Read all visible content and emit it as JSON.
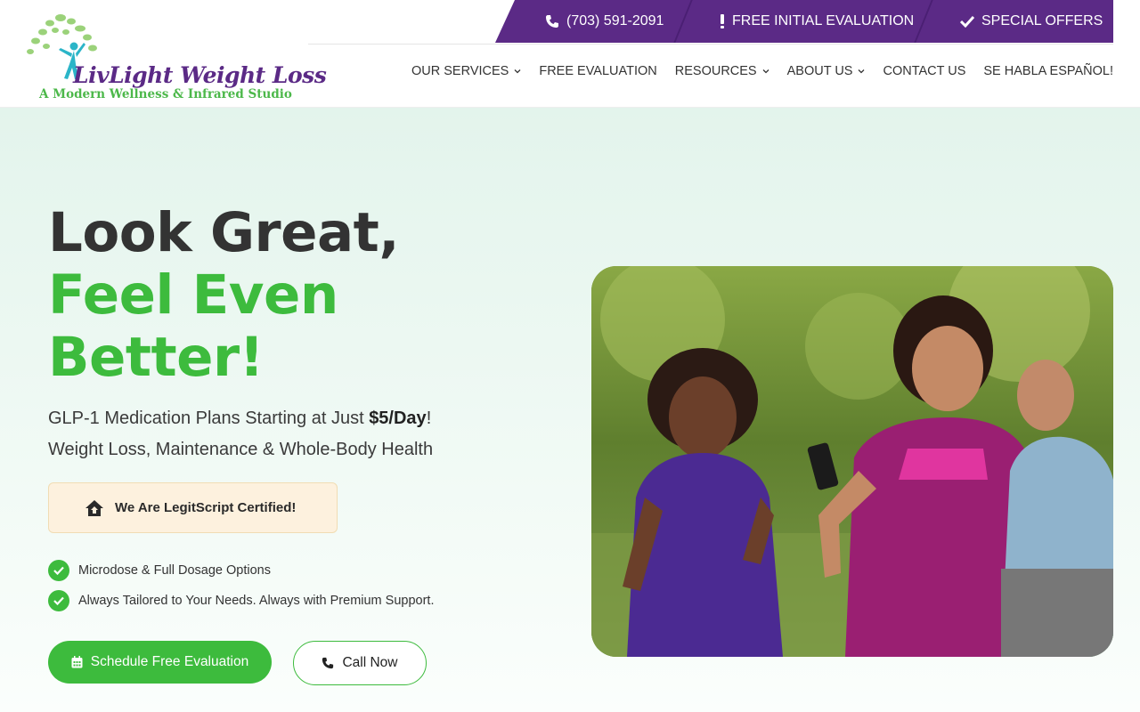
{
  "brand": {
    "name": "LivLight Weight Loss",
    "tagline": "A Modern Wellness & Infrared Studio",
    "colors": {
      "purple": "#5b2a86",
      "green": "#3dbb3d",
      "cert_bg": "#fdf1de"
    }
  },
  "topbar": {
    "phone": {
      "icon": "phone-icon",
      "label": "(703) 591-2091"
    },
    "evaluation": {
      "icon": "exclamation-icon",
      "label": "FREE INITIAL EVALUATION"
    },
    "offers": {
      "icon": "check-icon",
      "label": "SPECIAL OFFERS"
    }
  },
  "nav": {
    "services": "OUR SERVICES",
    "free_evaluation": "FREE EVALUATION",
    "resources": "RESOURCES",
    "about": "ABOUT US",
    "contact": "CONTACT US",
    "spanish": "SE HABLA ESPAÑOL!"
  },
  "hero": {
    "headline_line1": "Look Great,",
    "headline_line2": "Feel Even",
    "headline_line3": "Better!",
    "sub_line1_prefix": "GLP-1 Medication Plans Starting at Just ",
    "sub_line1_bold": "$5/Day",
    "sub_line1_suffix": "!",
    "sub_line2": "Weight Loss, Maintenance & Whole-Body Health",
    "cert_label": "We Are LegitScript Certified!",
    "checks": [
      "Microdose & Full Dosage Options",
      "Always Tailored to Your Needs. Always with Premium Support."
    ],
    "cta_primary": "Schedule Free Evaluation",
    "cta_secondary": "Call Now"
  }
}
